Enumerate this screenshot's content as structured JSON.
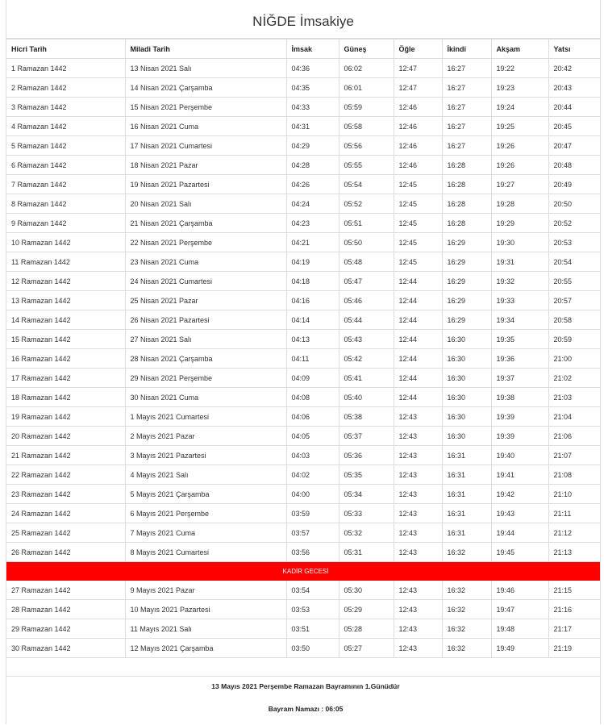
{
  "title": "NİĞDE İmsakiye",
  "columns": [
    "Hicri Tarih",
    "Miladi Tarih",
    "İmsak",
    "Güneş",
    "Öğle",
    "İkindi",
    "Akşam",
    "Yatsı"
  ],
  "rows_before": [
    [
      "1 Ramazan 1442",
      "13 Nisan 2021 Salı",
      "04:36",
      "06:02",
      "12:47",
      "16:27",
      "19:22",
      "20:42"
    ],
    [
      "2 Ramazan 1442",
      "14 Nisan 2021 Çarşamba",
      "04:35",
      "06:01",
      "12:47",
      "16:27",
      "19:23",
      "20:43"
    ],
    [
      "3 Ramazan 1442",
      "15 Nisan 2021 Perşembe",
      "04:33",
      "05:59",
      "12:46",
      "16:27",
      "19:24",
      "20:44"
    ],
    [
      "4 Ramazan 1442",
      "16 Nisan 2021 Cuma",
      "04:31",
      "05:58",
      "12:46",
      "16:27",
      "19:25",
      "20:45"
    ],
    [
      "5 Ramazan 1442",
      "17 Nisan 2021 Cumartesi",
      "04:29",
      "05:56",
      "12:46",
      "16:27",
      "19:26",
      "20:47"
    ],
    [
      "6 Ramazan 1442",
      "18 Nisan 2021 Pazar",
      "04:28",
      "05:55",
      "12:46",
      "16:28",
      "19:26",
      "20:48"
    ],
    [
      "7 Ramazan 1442",
      "19 Nisan 2021 Pazartesi",
      "04:26",
      "05:54",
      "12:45",
      "16:28",
      "19:27",
      "20:49"
    ],
    [
      "8 Ramazan 1442",
      "20 Nisan 2021 Salı",
      "04:24",
      "05:52",
      "12:45",
      "16:28",
      "19:28",
      "20:50"
    ],
    [
      "9 Ramazan 1442",
      "21 Nisan 2021 Çarşamba",
      "04:23",
      "05:51",
      "12:45",
      "16:28",
      "19:29",
      "20:52"
    ],
    [
      "10 Ramazan 1442",
      "22 Nisan 2021 Perşembe",
      "04:21",
      "05:50",
      "12:45",
      "16:29",
      "19:30",
      "20:53"
    ],
    [
      "11 Ramazan 1442",
      "23 Nisan 2021 Cuma",
      "04:19",
      "05:48",
      "12:45",
      "16:29",
      "19:31",
      "20:54"
    ],
    [
      "12 Ramazan 1442",
      "24 Nisan 2021 Cumartesi",
      "04:18",
      "05:47",
      "12:44",
      "16:29",
      "19:32",
      "20:55"
    ],
    [
      "13 Ramazan 1442",
      "25 Nisan 2021 Pazar",
      "04:16",
      "05:46",
      "12:44",
      "16:29",
      "19:33",
      "20:57"
    ],
    [
      "14 Ramazan 1442",
      "26 Nisan 2021 Pazartesi",
      "04:14",
      "05:44",
      "12:44",
      "16:29",
      "19:34",
      "20:58"
    ],
    [
      "15 Ramazan 1442",
      "27 Nisan 2021 Salı",
      "04:13",
      "05:43",
      "12:44",
      "16:30",
      "19:35",
      "20:59"
    ],
    [
      "16 Ramazan 1442",
      "28 Nisan 2021 Çarşamba",
      "04:11",
      "05:42",
      "12:44",
      "16:30",
      "19:36",
      "21:00"
    ],
    [
      "17 Ramazan 1442",
      "29 Nisan 2021 Perşembe",
      "04:09",
      "05:41",
      "12:44",
      "16:30",
      "19:37",
      "21:02"
    ],
    [
      "18 Ramazan 1442",
      "30 Nisan 2021 Cuma",
      "04:08",
      "05:40",
      "12:44",
      "16:30",
      "19:38",
      "21:03"
    ],
    [
      "19 Ramazan 1442",
      "1 Mayıs 2021 Cumartesi",
      "04:06",
      "05:38",
      "12:43",
      "16:30",
      "19:39",
      "21:04"
    ],
    [
      "20 Ramazan 1442",
      "2 Mayıs 2021 Pazar",
      "04:05",
      "05:37",
      "12:43",
      "16:30",
      "19:39",
      "21:06"
    ],
    [
      "21 Ramazan 1442",
      "3 Mayıs 2021 Pazartesi",
      "04:03",
      "05:36",
      "12:43",
      "16:31",
      "19:40",
      "21:07"
    ],
    [
      "22 Ramazan 1442",
      "4 Mayıs 2021 Salı",
      "04:02",
      "05:35",
      "12:43",
      "16:31",
      "19:41",
      "21:08"
    ],
    [
      "23 Ramazan 1442",
      "5 Mayıs 2021 Çarşamba",
      "04:00",
      "05:34",
      "12:43",
      "16:31",
      "19:42",
      "21:10"
    ],
    [
      "24 Ramazan 1442",
      "6 Mayıs 2021 Perşembe",
      "03:59",
      "05:33",
      "12:43",
      "16:31",
      "19:43",
      "21:11"
    ],
    [
      "25 Ramazan 1442",
      "7 Mayıs 2021 Cuma",
      "03:57",
      "05:32",
      "12:43",
      "16:31",
      "19:44",
      "21:12"
    ],
    [
      "26 Ramazan 1442",
      "8 Mayıs 2021 Cumartesi",
      "03:56",
      "05:31",
      "12:43",
      "16:32",
      "19:45",
      "21:13"
    ]
  ],
  "special_row": {
    "label": "KADİR GECESİ",
    "color": "#ff0000"
  },
  "rows_after": [
    [
      "27 Ramazan 1442",
      "9 Mayıs 2021 Pazar",
      "03:54",
      "05:30",
      "12:43",
      "16:32",
      "19:46",
      "21:15"
    ],
    [
      "28 Ramazan 1442",
      "10 Mayıs 2021 Pazartesi",
      "03:53",
      "05:29",
      "12:43",
      "16:32",
      "19:47",
      "21:16"
    ],
    [
      "29 Ramazan 1442",
      "11 Mayıs 2021 Salı",
      "03:51",
      "05:28",
      "12:43",
      "16:32",
      "19:48",
      "21:17"
    ],
    [
      "30 Ramazan 1442",
      "12 Mayıs 2021 Çarşamba",
      "03:50",
      "05:27",
      "12:43",
      "16:32",
      "19:49",
      "21:19"
    ]
  ],
  "footer": {
    "bayram_day": "13 Mayıs 2021 Perşembe Ramazan Bayramının 1.Günüdür",
    "bayram_namazi": "Bayram Namazı : 06:05"
  }
}
